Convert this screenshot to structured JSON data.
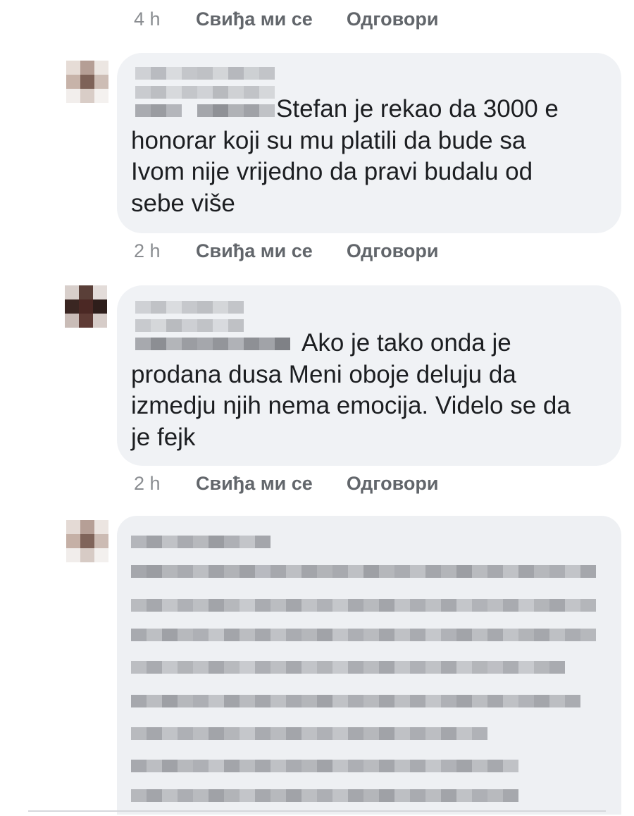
{
  "comments": [
    {
      "time": "4 h",
      "like_label": "Свиђа ми се",
      "reply_label": "Одговори"
    },
    {
      "text": "Stefan je rekao da 3000 e\nhonorar koji su mu platili da bude sa\nIvom nije vrijedno da pravi budalu od\nsebe više",
      "time": "2 h",
      "like_label": "Свиђа ми се",
      "reply_label": "Одговори"
    },
    {
      "text": "Ako je tako onda je\nprodana dusa Meni oboje deluju da\nizmedju njih nema emocija. Videlo se da\nje fejk",
      "time": "2 h",
      "like_label": "Свиђа ми се",
      "reply_label": "Одговори"
    }
  ],
  "colors": {
    "bubble_bg": "#f0f2f5",
    "meta_text": "#62666b",
    "time_text": "#8a8d91",
    "body_text": "#1c1e21"
  }
}
